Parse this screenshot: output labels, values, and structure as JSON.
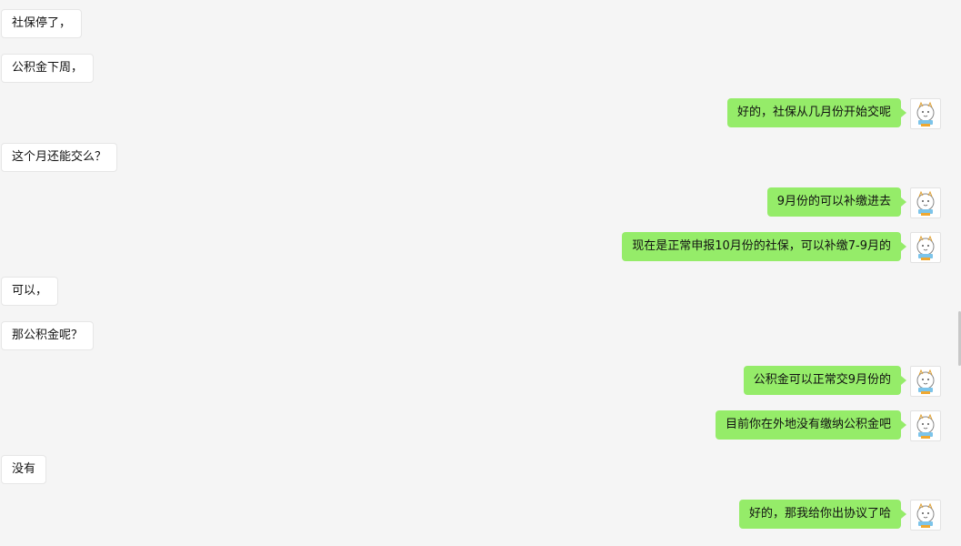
{
  "messages": [
    {
      "direction": "in",
      "text": "社保停了，"
    },
    {
      "direction": "in",
      "text": "公积金下周，"
    },
    {
      "direction": "out",
      "text": "好的，社保从几月份开始交呢"
    },
    {
      "direction": "in",
      "text": "这个月还能交么？"
    },
    {
      "direction": "out",
      "text": "9月份的可以补缴进去"
    },
    {
      "direction": "out",
      "text": "现在是正常申报10月份的社保，可以补缴7-9月的"
    },
    {
      "direction": "in",
      "text": "可以，"
    },
    {
      "direction": "in",
      "text": "那公积金呢？"
    },
    {
      "direction": "out",
      "text": "公积金可以正常交9月份的"
    },
    {
      "direction": "out",
      "text": "目前你在外地没有缴纳公积金吧"
    },
    {
      "direction": "in",
      "text": "没有"
    },
    {
      "direction": "out",
      "text": "好的，那我给你出协议了哈"
    }
  ],
  "colors": {
    "background": "#f5f5f5",
    "incoming_bubble": "#ffffff",
    "outgoing_bubble": "#95ec69"
  },
  "icons": {
    "avatar": "cartoon-cat-avatar-icon"
  }
}
